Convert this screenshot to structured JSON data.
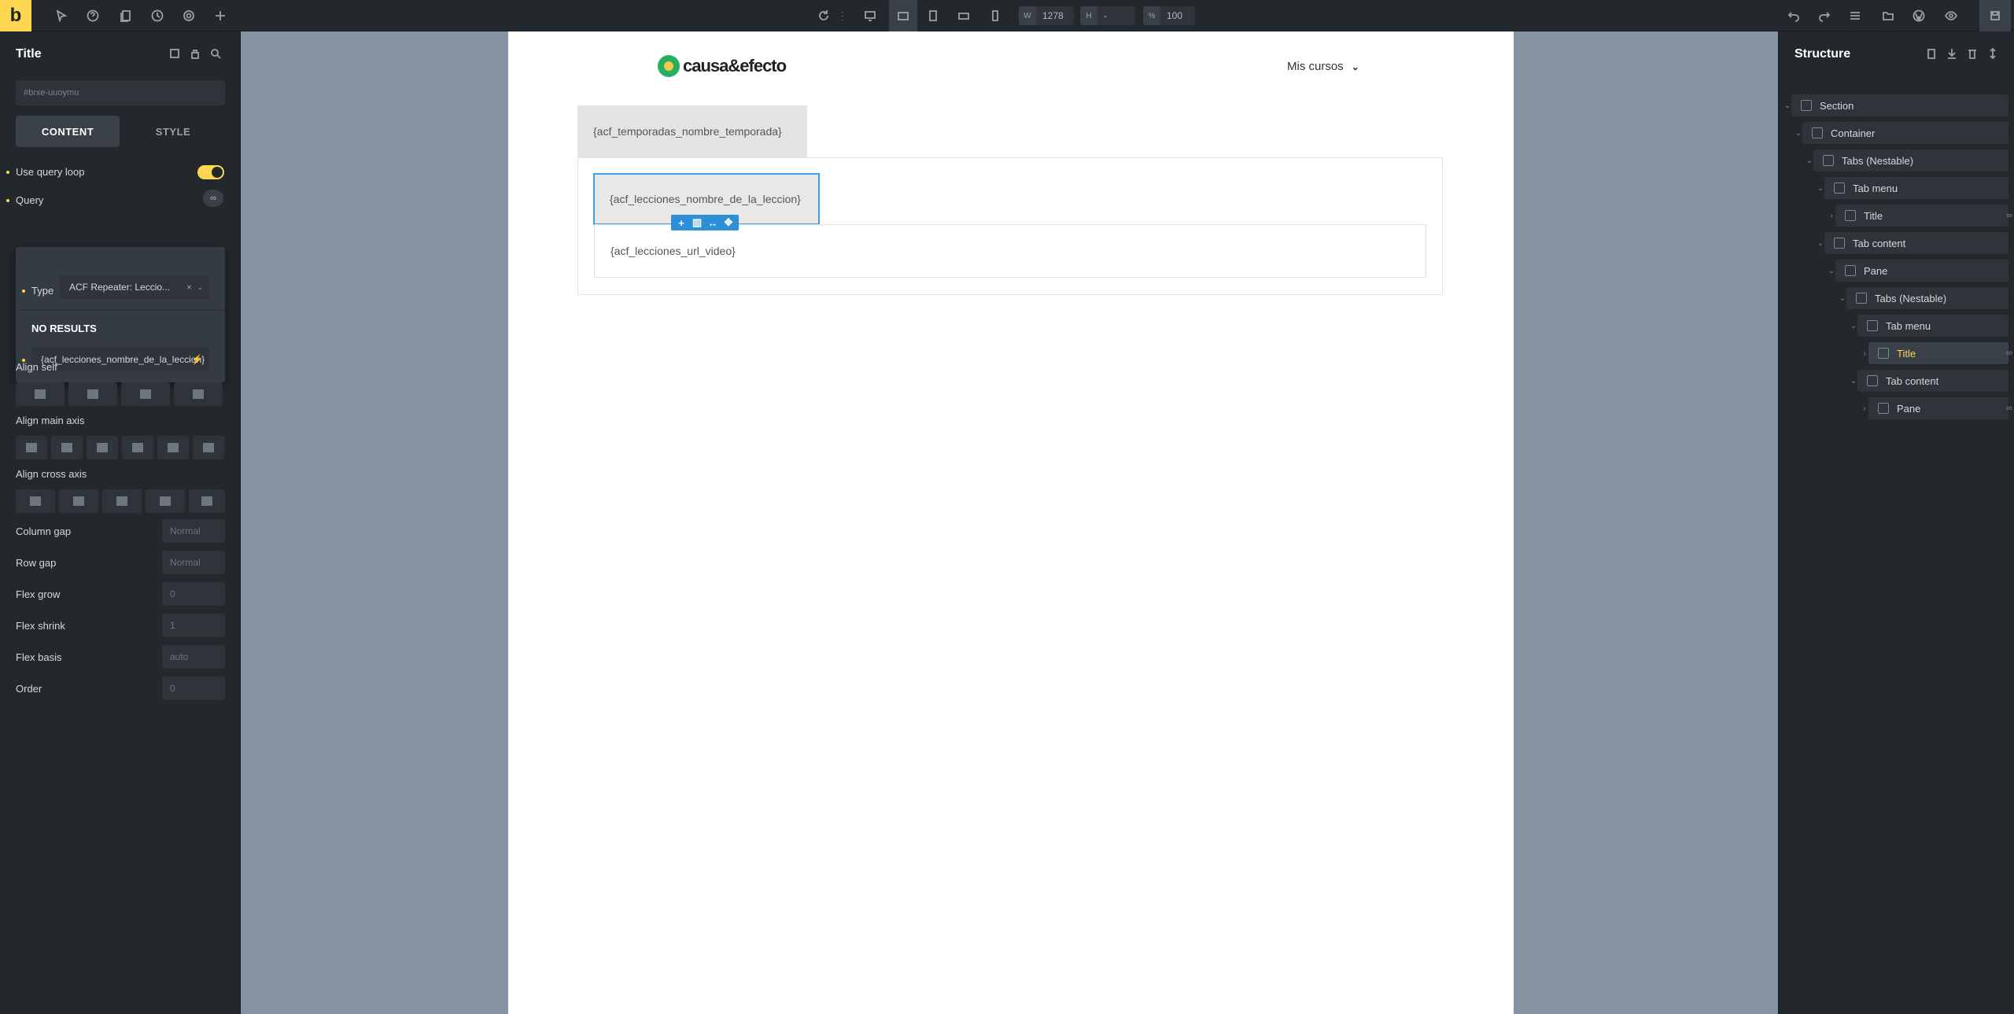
{
  "topbar": {
    "brand": "b",
    "width_label": "W",
    "width_value": "1278",
    "height_label": "H",
    "height_value": "-",
    "zoom_label": "%",
    "zoom_value": "100"
  },
  "left_panel": {
    "title": "Title",
    "element_id": "#brxe-uuoymu",
    "tabs": {
      "content": "CONTENT",
      "style": "STYLE"
    },
    "use_query_loop": "Use query loop",
    "query": "Query",
    "query_popup": {
      "type_label": "Type",
      "type_value": "ACF Repeater: Leccio...",
      "no_results": "NO RESULTS",
      "search_value": "{acf_lecciones_nombre_de_la_leccion}"
    },
    "align_self": "Align self",
    "align_main_axis": "Align main axis",
    "align_cross_axis": "Align cross axis",
    "column_gap": {
      "label": "Column gap",
      "placeholder": "Normal"
    },
    "row_gap": {
      "label": "Row gap",
      "placeholder": "Normal"
    },
    "flex_grow": {
      "label": "Flex grow",
      "placeholder": "0"
    },
    "flex_shrink": {
      "label": "Flex shrink",
      "placeholder": "1"
    },
    "flex_basis": {
      "label": "Flex basis",
      "placeholder": "auto"
    },
    "order": {
      "label": "Order",
      "placeholder": "0"
    }
  },
  "canvas": {
    "logo_text": "causa&efecto",
    "nav_item": "Mis cursos",
    "outer_tab_title": "{acf_temporadas_nombre_temporada}",
    "inner_tab_title": "{acf_lecciones_nombre_de_la_leccion}",
    "inner_pane_text": "{acf_lecciones_url_video}"
  },
  "structure": {
    "title": "Structure",
    "nodes": [
      {
        "label": "Section"
      },
      {
        "label": "Container"
      },
      {
        "label": "Tabs (Nestable)"
      },
      {
        "label": "Tab menu"
      },
      {
        "label": "Title"
      },
      {
        "label": "Tab content"
      },
      {
        "label": "Pane"
      },
      {
        "label": "Tabs (Nestable)"
      },
      {
        "label": "Tab menu"
      },
      {
        "label": "Title"
      },
      {
        "label": "Tab content"
      },
      {
        "label": "Pane"
      }
    ]
  },
  "colors": {
    "accent": "#ffd64f",
    "selection": "#3b9ee8",
    "panel": "#23282d"
  }
}
